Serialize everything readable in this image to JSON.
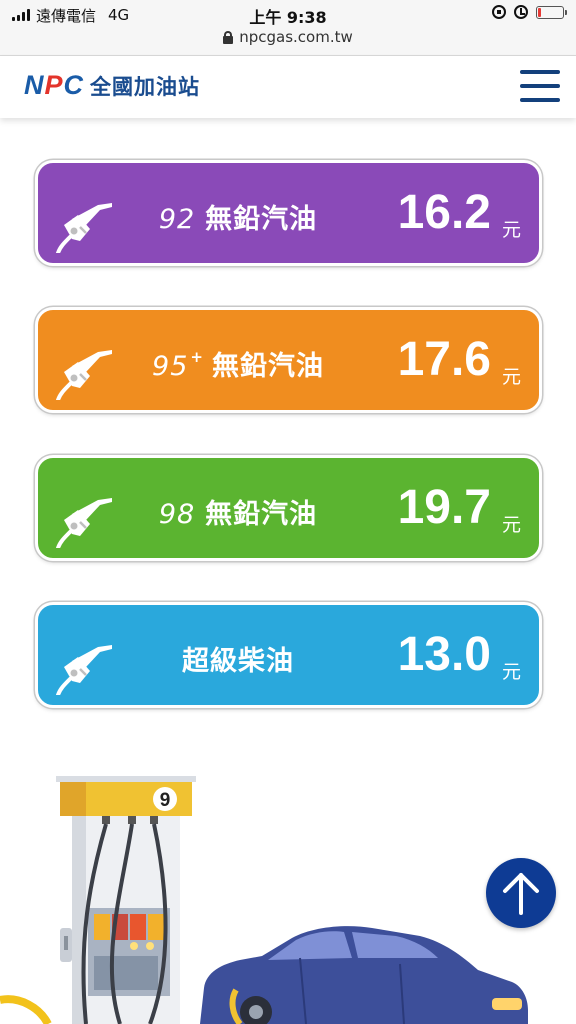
{
  "status_bar": {
    "carrier": "遠傳電信",
    "network": "4G",
    "time": "上午 9:38",
    "url": "npcgas.com.tw",
    "battery_fraction": 0.12
  },
  "header": {
    "logo_text_n": "N",
    "logo_text_p": "P",
    "logo_text_c": "C",
    "site_name": "全國加油站",
    "menu_icon": "hamburger-menu-icon"
  },
  "colors": {
    "card_92": "#8a4ab8",
    "card_95": "#f08d1f",
    "card_98": "#5bb430",
    "card_diesel": "#2aa8dc",
    "brand_blue": "#1a4c8f",
    "brand_red": "#e3342b",
    "scroll_top": "#0e3b94"
  },
  "prices": [
    {
      "grade": "92",
      "sup": "",
      "name": "無鉛汽油",
      "price": "16.2",
      "unit": "元"
    },
    {
      "grade": "95",
      "sup": "+",
      "name": "無鉛汽油",
      "price": "17.6",
      "unit": "元"
    },
    {
      "grade": "98",
      "sup": "",
      "name": "無鉛汽油",
      "price": "19.7",
      "unit": "元"
    },
    {
      "grade": "",
      "sup": "",
      "name": "超級柴油",
      "price": "13.0",
      "unit": "元"
    }
  ],
  "illustration": {
    "pump_number": "9"
  },
  "scroll_top_icon": "arrow-up-icon"
}
